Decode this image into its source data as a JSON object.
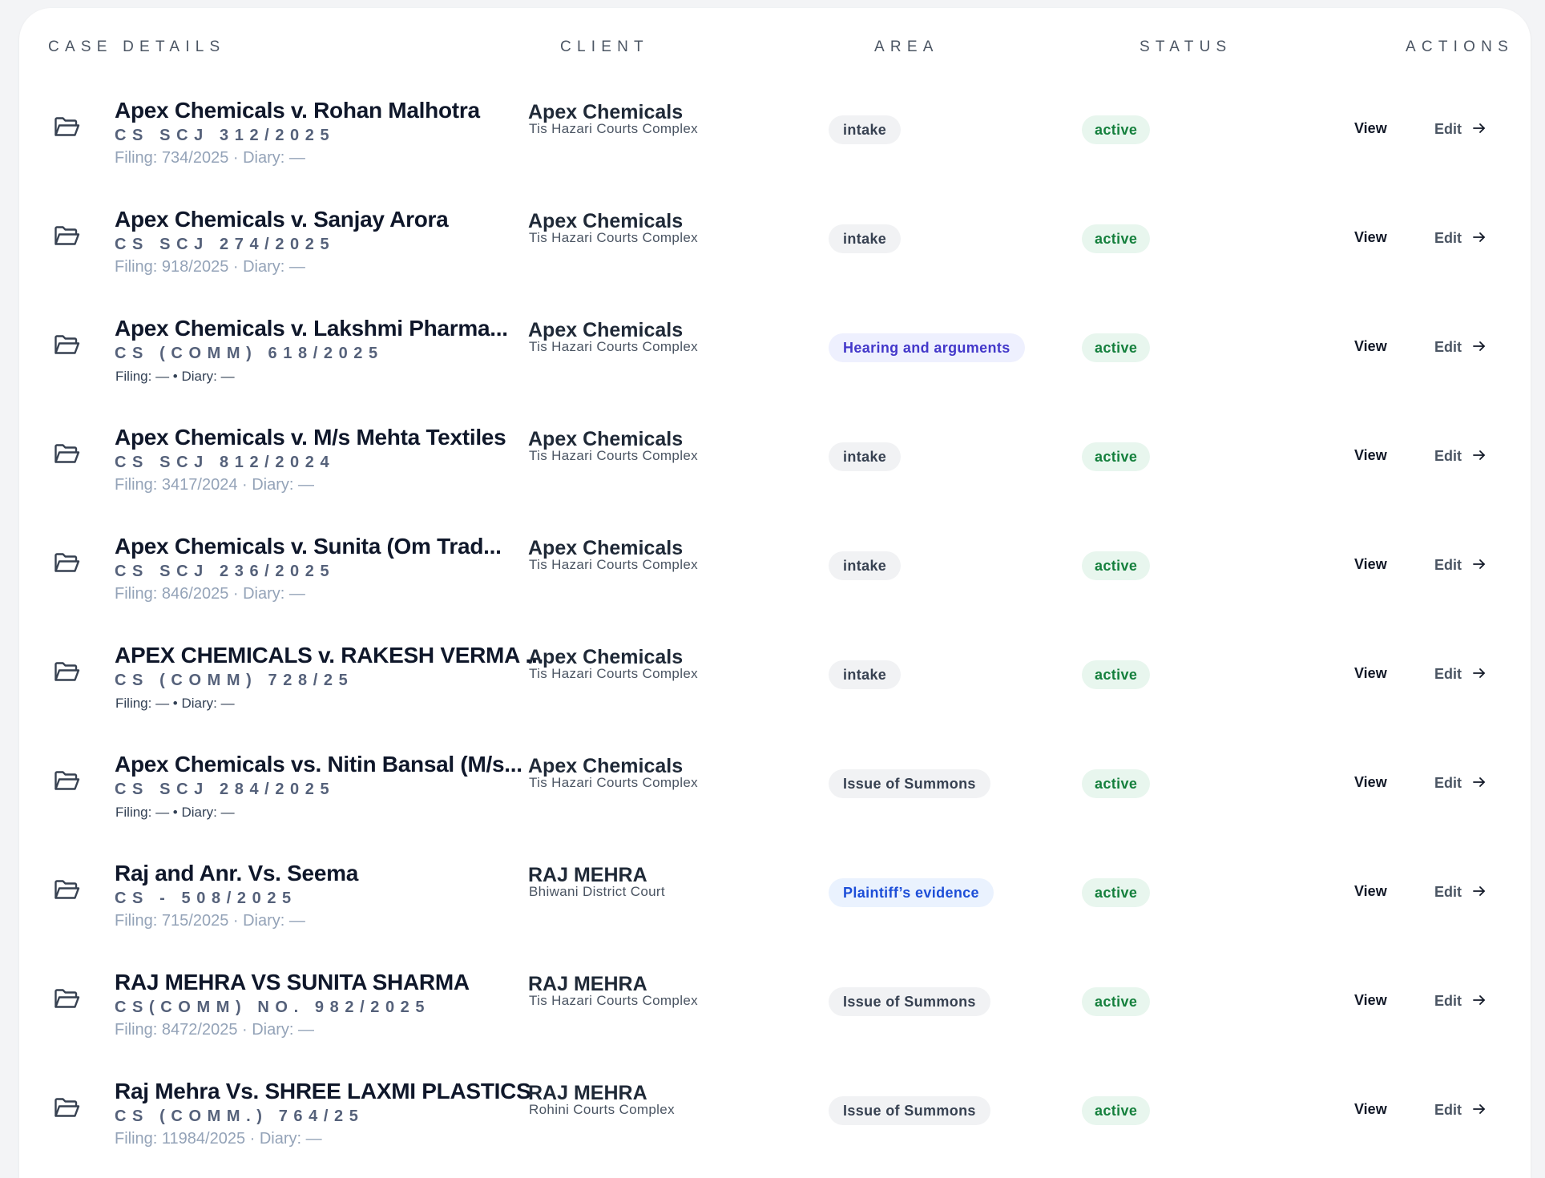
{
  "header": {
    "case_details": "CASE DETAILS",
    "client": "CLIENT",
    "area": "AREA",
    "status": "STATUS",
    "actions": "ACTIONS"
  },
  "actions": {
    "view_label": "View",
    "edit_label": "Edit"
  },
  "icons": {
    "row_icon": "folder-open-icon",
    "edit_icon": "arrow-right-icon"
  },
  "colors": {
    "status_active_bg": "#e8f6ee",
    "status_active_fg": "#15803d",
    "area_default_bg": "#f1f2f4",
    "area_indigo_fg": "#4338ca",
    "area_blue_fg": "#1d4ed8"
  },
  "cases": [
    {
      "title": "Apex Chemicals v. Rohan Malhotra",
      "case_no": "CS SCJ 312/2025",
      "filing": "Filing: 734/2025 · Diary: —",
      "filing_style": "muted",
      "client": "Apex Chemicals",
      "court": "Tis Hazari Courts Complex",
      "area": "intake",
      "area_style": "default",
      "status": "active"
    },
    {
      "title": "Apex Chemicals v. Sanjay Arora",
      "case_no": "CS SCJ 274/2025",
      "filing": "Filing: 918/2025 · Diary: —",
      "filing_style": "muted",
      "client": "Apex Chemicals",
      "court": "Tis Hazari Courts Complex",
      "area": "intake",
      "area_style": "default",
      "status": "active"
    },
    {
      "title": "Apex Chemicals v. Lakshmi Pharma...",
      "case_no": "CS (COMM) 618/2025",
      "filing": "Filing: — • Diary: —",
      "filing_style": "dark",
      "client": "Apex Chemicals",
      "court": "Tis Hazari Courts Complex",
      "area": "Hearing and arguments",
      "area_style": "indigo",
      "status": "active"
    },
    {
      "title": "Apex Chemicals v. M/s Mehta Textiles",
      "case_no": "CS SCJ 812/2024",
      "filing": "Filing: 3417/2024 · Diary: —",
      "filing_style": "muted",
      "client": "Apex Chemicals",
      "court": "Tis Hazari Courts Complex",
      "area": "intake",
      "area_style": "default",
      "status": "active"
    },
    {
      "title": "Apex Chemicals v. Sunita (Om Trad...",
      "case_no": "CS SCJ 236/2025",
      "filing": "Filing: 846/2025 · Diary: —",
      "filing_style": "muted",
      "client": "Apex Chemicals",
      "court": "Tis Hazari Courts Complex",
      "area": "intake",
      "area_style": "default",
      "status": "active"
    },
    {
      "title": "APEX CHEMICALS v. RAKESH VERMA ...",
      "case_no": "CS (COMM) 728/25",
      "filing": "Filing: — • Diary: —",
      "filing_style": "dark",
      "client": "Apex Chemicals",
      "court": "Tis Hazari Courts Complex",
      "area": "intake",
      "area_style": "default",
      "status": "active"
    },
    {
      "title": "Apex Chemicals vs. Nitin Bansal (M/s...",
      "case_no": "CS SCJ 284/2025",
      "filing": "Filing: — • Diary: —",
      "filing_style": "dark",
      "client": "Apex Chemicals",
      "court": "Tis Hazari Courts Complex",
      "area": "Issue of Summons",
      "area_style": "default",
      "status": "active"
    },
    {
      "title": "Raj and Anr. Vs. Seema",
      "case_no": "CS - 508/2025",
      "filing": "Filing: 715/2025 · Diary: —",
      "filing_style": "muted",
      "client": "RAJ MEHRA",
      "court": "Bhiwani District Court",
      "area": "Plaintiff’s evidence",
      "area_style": "blue",
      "status": "active"
    },
    {
      "title": "RAJ MEHRA VS SUNITA SHARMA",
      "case_no": "CS(COMM) NO. 982/2025",
      "filing": "Filing: 8472/2025 · Diary: —",
      "filing_style": "muted",
      "client": "RAJ MEHRA",
      "court": "Tis Hazari Courts Complex",
      "area": "Issue of Summons",
      "area_style": "default",
      "status": "active"
    },
    {
      "title": "Raj Mehra Vs. SHREE LAXMI PLASTICS",
      "case_no": "CS (COMM.) 764/25",
      "filing": "Filing: 11984/2025 · Diary: —",
      "filing_style": "muted",
      "client": "RAJ MEHRA",
      "court": "Rohini Courts Complex",
      "area": "Issue of Summons",
      "area_style": "default",
      "status": "active"
    }
  ]
}
